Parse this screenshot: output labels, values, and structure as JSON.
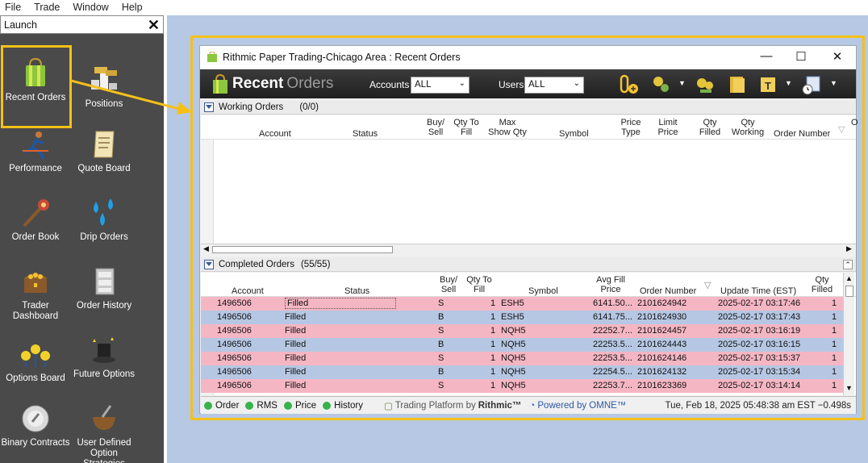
{
  "menu": [
    "File",
    "Trade",
    "Window",
    "Help"
  ],
  "launch": {
    "title": "Launch",
    "close": "✕",
    "tiles": [
      {
        "label": "Recent Orders",
        "icon": "recent-orders-icon"
      },
      {
        "label": "Positions",
        "icon": "positions-icon"
      },
      {
        "label": "Performance",
        "icon": "performance-icon"
      },
      {
        "label": "Quote Board",
        "icon": "quote-board-icon"
      },
      {
        "label": "Order Book",
        "icon": "order-book-icon"
      },
      {
        "label": "Drip Orders",
        "icon": "drip-orders-icon"
      },
      {
        "label": "Trader Dashboard",
        "icon": "trader-dashboard-icon"
      },
      {
        "label": "Order History",
        "icon": "order-history-icon"
      },
      {
        "label": "Options Board",
        "icon": "options-board-icon"
      },
      {
        "label": "Future Options",
        "icon": "future-options-icon"
      },
      {
        "label": "Binary Contracts",
        "icon": "binary-contracts-icon"
      },
      {
        "label": "User Defined Option Strategies",
        "icon": "user-defined-option-strategies-icon"
      }
    ]
  },
  "window": {
    "title": "Rithmic Paper Trading-Chicago Area : Recent Orders",
    "minimize": "—",
    "maximize": "☐",
    "close": "✕",
    "brand_word1": "Recent",
    "brand_word2": "Orders",
    "accounts_label": "Accounts",
    "accounts_value": "ALL",
    "users_label": "Users",
    "users_value": "ALL"
  },
  "working": {
    "title": "Working Orders",
    "count": "(0/0)",
    "headers": {
      "account": "Account",
      "status": "Status",
      "buysell": "Buy/ Sell",
      "qty_to_fill": "Qty To Fill",
      "max_show": "Max Show Qty",
      "symbol": "Symbol",
      "price_type": "Price Type",
      "limit_price": "Limit Price",
      "qty_filled": "Qty Filled",
      "qty_working": "Qty Working",
      "order_number": "Order Number",
      "extra": "O"
    }
  },
  "completed": {
    "title": "Completed Orders",
    "count": "(55/55)",
    "headers": {
      "account": "Account",
      "status": "Status",
      "buysell": "Buy/ Sell",
      "qty_to_fill": "Qty To Fill",
      "symbol": "Symbol",
      "avg_fill": "Avg Fill Price",
      "order_number": "Order Number",
      "update_time": "Update Time (EST)",
      "qty_filled": "Qty Filled"
    },
    "rows": [
      {
        "account": "1496506",
        "status": "Filled",
        "side": "S",
        "qty": "1",
        "symbol": "ESH5",
        "avg": "6141.50...",
        "order": "2101624942",
        "time": "2025-02-17 03:17:46",
        "filled": "1",
        "color": "#f5b6c3"
      },
      {
        "account": "1496506",
        "status": "Filled",
        "side": "B",
        "qty": "1",
        "symbol": "ESH5",
        "avg": "6141.75...",
        "order": "2101624930",
        "time": "2025-02-17 03:17:43",
        "filled": "1",
        "color": "#b5c7e3"
      },
      {
        "account": "1496506",
        "status": "Filled",
        "side": "S",
        "qty": "1",
        "symbol": "NQH5",
        "avg": "22252.7...",
        "order": "2101624457",
        "time": "2025-02-17 03:16:19",
        "filled": "1",
        "color": "#f5b6c3"
      },
      {
        "account": "1496506",
        "status": "Filled",
        "side": "B",
        "qty": "1",
        "symbol": "NQH5",
        "avg": "22253.5...",
        "order": "2101624443",
        "time": "2025-02-17 03:16:15",
        "filled": "1",
        "color": "#b5c7e3"
      },
      {
        "account": "1496506",
        "status": "Filled",
        "side": "S",
        "qty": "1",
        "symbol": "NQH5",
        "avg": "22253.5...",
        "order": "2101624146",
        "time": "2025-02-17 03:15:37",
        "filled": "1",
        "color": "#f5b6c3"
      },
      {
        "account": "1496506",
        "status": "Filled",
        "side": "B",
        "qty": "1",
        "symbol": "NQH5",
        "avg": "22254.5...",
        "order": "2101624132",
        "time": "2025-02-17 03:15:34",
        "filled": "1",
        "color": "#b5c7e3"
      },
      {
        "account": "1496506",
        "status": "Filled",
        "side": "S",
        "qty": "1",
        "symbol": "NQH5",
        "avg": "22253.7...",
        "order": "2101623369",
        "time": "2025-02-17 03:14:14",
        "filled": "1",
        "color": "#f5b6c3"
      }
    ]
  },
  "statusbar": {
    "items": [
      "Order",
      "RMS",
      "Price",
      "History"
    ],
    "dot_color": "#38b24a",
    "platform_text": "Trading Platform by",
    "platform_brand": "Rithmic™",
    "powered": "Powered by OMNE™",
    "clock": "Tue, Feb 18, 2025 05:48:38 am EST −0.498s"
  },
  "colors": {
    "highlight": "#f5c118",
    "desktop": "#b6c8e4",
    "launch_bg": "#4a4a4a"
  }
}
